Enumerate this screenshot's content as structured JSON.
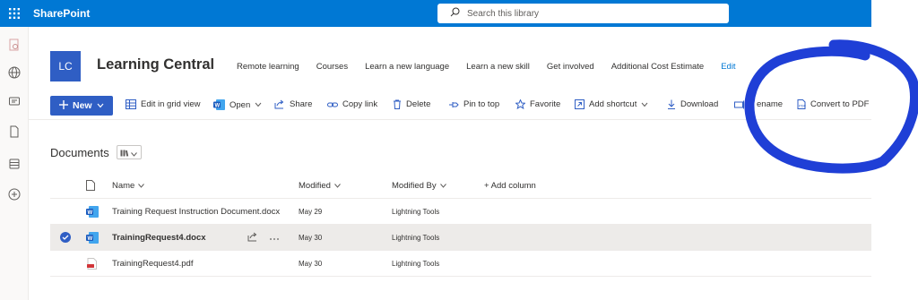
{
  "suite": {
    "app_name": "SharePoint",
    "search_placeholder": "Search this library"
  },
  "site": {
    "logo_text": "LC",
    "title": "Learning Central",
    "nav": [
      "Remote learning",
      "Courses",
      "Learn a new language",
      "Learn a new skill",
      "Get involved",
      "Additional Cost Estimate"
    ],
    "edit_label": "Edit"
  },
  "command_bar": {
    "new_label": "New",
    "edit_grid": "Edit in grid view",
    "open": "Open",
    "share": "Share",
    "copy_link": "Copy link",
    "delete": "Delete",
    "pin_to_top": "Pin to top",
    "favorite": "Favorite",
    "add_shortcut": "Add shortcut",
    "download": "Download",
    "rename": "ename",
    "convert_to_pdf": "Convert to PDF"
  },
  "library": {
    "title": "Documents",
    "columns": {
      "name": "Name",
      "modified": "Modified",
      "modified_by": "Modified By",
      "add_column": "+ Add column"
    },
    "files": [
      {
        "name": "Training Request Instruction Document.docx",
        "modified": "May 29",
        "modified_by": "Lightning Tools",
        "type": "word",
        "selected": false
      },
      {
        "name": "TrainingRequest4.docx",
        "modified": "May 30",
        "modified_by": "Lightning Tools",
        "type": "word",
        "selected": true
      },
      {
        "name": "TrainingRequest4.pdf",
        "modified": "May 30",
        "modified_by": "Lightning Tools",
        "type": "pdf",
        "selected": false
      }
    ]
  },
  "colors": {
    "brand": "#0078d4",
    "accent": "#2f5ec4",
    "annotation": "#1f3fd6"
  }
}
